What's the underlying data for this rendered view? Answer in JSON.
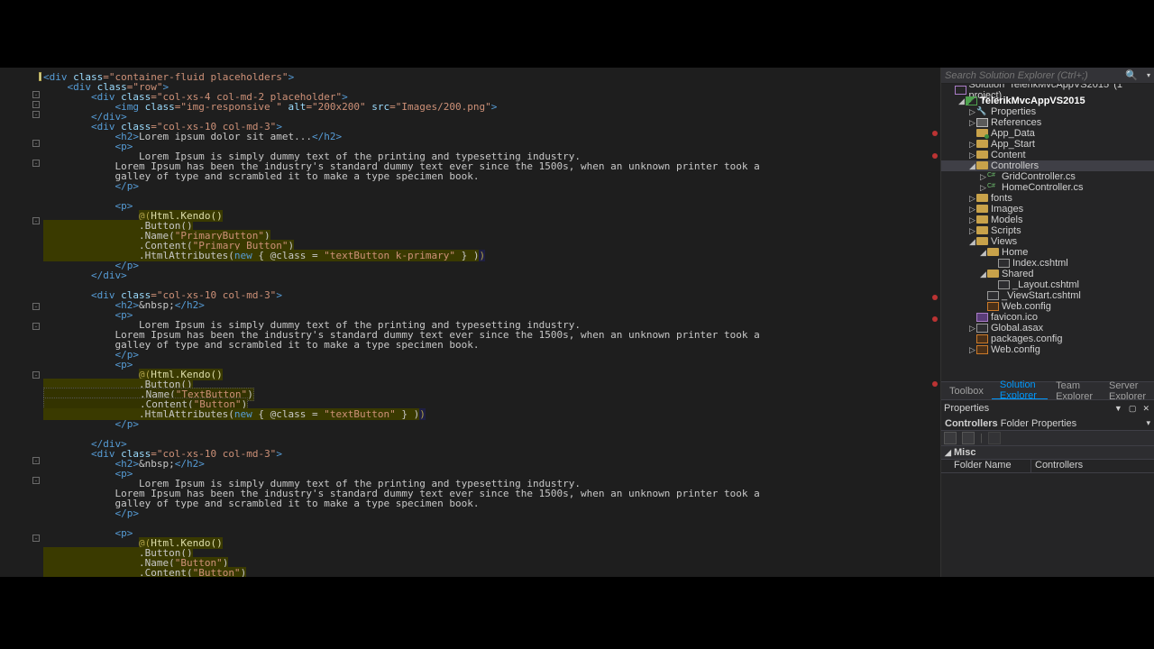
{
  "search": {
    "placeholder": "Search Solution Explorer (Ctrl+;)"
  },
  "solution": {
    "label": "Solution 'TelerikMvcAppVS2015' (1 project)",
    "project": "TelerikMvcAppVS2015"
  },
  "tree": {
    "properties": "Properties",
    "references": "References",
    "app_data": "App_Data",
    "app_start": "App_Start",
    "content": "Content",
    "controllers": "Controllers",
    "gridcontroller": "GridController.cs",
    "homecontroller": "HomeController.cs",
    "fonts": "fonts",
    "images": "Images",
    "models": "Models",
    "scripts": "Scripts",
    "views": "Views",
    "home": "Home",
    "index": "Index.cshtml",
    "shared": "Shared",
    "layout": "_Layout.cshtml",
    "viewstart": "_ViewStart.cshtml",
    "webconfig1": "Web.config",
    "favicon": "favicon.ico",
    "globalasax": "Global.asax",
    "packages": "packages.config",
    "webconfig2": "Web.config"
  },
  "tabs": {
    "toolbox": "Toolbox",
    "solution": "Solution Explorer",
    "team": "Team Explorer",
    "server": "Server Explorer"
  },
  "props": {
    "title": "Properties",
    "subtitle": "Controllers Folder Properties",
    "misc": "Misc",
    "folderName": "Folder Name",
    "folderValue": "Controllers"
  },
  "code": {
    "l1a": "<div",
    "l1b": " class",
    "l1c": "=\"container-fluid placeholders\"",
    "l1d": ">",
    "l2a": "    <div",
    "l2b": " class",
    "l2c": "=\"row\"",
    "l2d": ">",
    "l3a": "        <div",
    "l3b": " class",
    "l3c": "=\"col-xs-4 col-md-2 placeholder\"",
    "l3d": ">",
    "l4a": "            <img",
    "l4b": " class",
    "l4c": "=\"img-responsive \"",
    "l4d": " alt",
    "l4e": "=\"200x200\"",
    "l4f": " src",
    "l4g": "=\"Images/200.png\"",
    "l4h": ">",
    "l5a": "        </div>",
    "l6a": "        <div",
    "l6b": " class",
    "l6c": "=\"col-xs-10 col-md-3\"",
    "l6d": ">",
    "l7a": "            <h2>",
    "l7b": "Lorem ipsum dolor sit amet...",
    "l7c": "</h2>",
    "l8a": "            <p>",
    "l9": "                Lorem Ipsum is simply dummy text of the printing and typesetting industry.",
    "l10": "            Lorem Ipsum has been the industry's standard dummy text ever since the 1500s, when an unknown printer took a",
    "l11": "            galley of type and scrambled it to make a type specimen book.",
    "l12": "            </p>",
    "l13": "            <p>",
    "r1a": "@(",
    "r1b": "Html.Kendo()",
    "r2": "                .Button()",
    "r3a": "                .Name(",
    "r3b": "\"PrimaryButton\"",
    "r3c": ")",
    "r4a": "                .Content(",
    "r4b": "\"Primary Button\"",
    "r4c": ")",
    "r5a": "                .HtmlAttributes(",
    "r5b": "new",
    "r5c": " { @class = ",
    "r5d": "\"textButton k-primary\"",
    "r5e": " } )",
    "r5f": ")",
    "l14": "            </p>",
    "l15": "        </div>",
    "bl": "",
    "l16a": "        <div",
    "l16b": " class",
    "l16c": "=\"col-xs-10 col-md-3\"",
    "l16d": ">",
    "l17a": "            <h2>",
    "l17b": "&nbsp;",
    "l17c": "</h2>",
    "l18": "            <p>",
    "l19": "                Lorem Ipsum is simply dummy text of the printing and typesetting industry.",
    "l20": "            Lorem Ipsum has been the industry's standard dummy text ever since the 1500s, when an unknown printer took a",
    "l21": "            galley of type and scrambled it to make a type specimen book.",
    "l22": "            </p>",
    "l23": "            <p>",
    "r6a": "@(",
    "r6b": "Html.Kendo()",
    "r7": "                .Button()",
    "r8a": "                .Name(",
    "r8b": "\"TextButton\"",
    "r8c": ")",
    "r9a": "                .Content(",
    "r9b": "\"Button\"",
    "r9c": ")",
    "r10a": "                .HtmlAttributes(",
    "r10b": "new",
    "r10c": " { @class = ",
    "r10d": "\"textButton\"",
    "r10e": " } )",
    "r10f": ")",
    "l24": "            </p>",
    "l25": "        </div>",
    "l26a": "        <div",
    "l26b": " class",
    "l26c": "=\"col-xs-10 col-md-3\"",
    "l26d": ">",
    "l27a": "            <h2>",
    "l27b": "&nbsp;",
    "l27c": "</h2>",
    "l28": "            <p>",
    "l29": "                Lorem Ipsum is simply dummy text of the printing and typesetting industry.",
    "l30": "            Lorem Ipsum has been the industry's standard dummy text ever since the 1500s, when an unknown printer took a",
    "l31": "            galley of type and scrambled it to make a type specimen book.",
    "l32": "            </p>",
    "l33": "            <p>",
    "r11a": "@(",
    "r11b": "Html.Kendo()",
    "r12": "                .Button()",
    "r13a": "                .Name(",
    "r13b": "\"Button\"",
    "r13c": ")",
    "r14a": "                .Content(",
    "r14b": "\"Button\"",
    "r14c": ")"
  }
}
